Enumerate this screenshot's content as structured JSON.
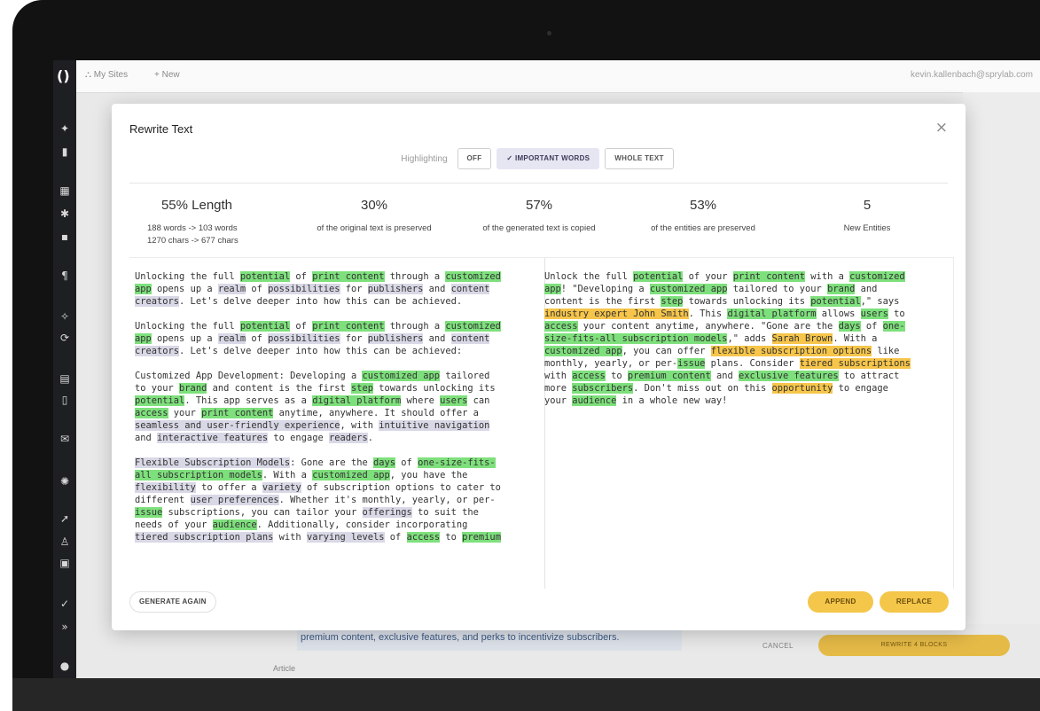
{
  "app": {
    "topbar": {
      "my_sites": "My Sites",
      "new": "+ New",
      "user_email": "kevin.kallenbach@sprylab.com"
    },
    "background": {
      "article_strip": "premium content, exclusive features, and perks to incentivize subscribers.",
      "article_label": "Article",
      "cancel_label": "CANCEL",
      "rewrite_label": "REWRITE 4 BLOCKS"
    }
  },
  "modal": {
    "title": "Rewrite Text",
    "close_icon": "×",
    "highlighting": {
      "label": "Highlighting",
      "options": [
        "OFF",
        "✓ IMPORTANT WORDS",
        "WHOLE TEXT"
      ],
      "selected": "IMPORTANT WORDS"
    },
    "stats": [
      {
        "value": "55% Length",
        "desc": "188 words -> 103 words\n1270 chars -> 677 chars"
      },
      {
        "value": "30%",
        "desc": "of the original text is preserved"
      },
      {
        "value": "57%",
        "desc": "of the generated text is copied"
      },
      {
        "value": "53%",
        "desc": "of the entities are preserved"
      },
      {
        "value": "5",
        "desc": "New Entities"
      }
    ],
    "buttons": {
      "generate_again": "GENERATE AGAIN",
      "append": "APPEND",
      "replace": "REPLACE"
    }
  },
  "colors": {
    "highlight_green": "#7ee07c",
    "highlight_yellow": "#f6c54a",
    "highlight_gray": "#d8d8e6",
    "button_yellow": "#f4c64a"
  },
  "original_text": [
    [
      [
        "Unlocking the full ",
        ""
      ],
      [
        "potential",
        "g"
      ],
      [
        " of ",
        ""
      ],
      [
        "print content",
        "g"
      ],
      [
        " through a ",
        ""
      ],
      [
        "customized\napp",
        "g"
      ],
      [
        " opens up a ",
        ""
      ],
      [
        "realm",
        "p"
      ],
      [
        " of ",
        ""
      ],
      [
        "possibilities",
        "p"
      ],
      [
        " for ",
        ""
      ],
      [
        "publishers",
        "p"
      ],
      [
        " and ",
        ""
      ],
      [
        "content\ncreators",
        "p"
      ],
      [
        ". Let's delve deeper into how this can be achieved.",
        ""
      ]
    ],
    [
      [
        "Unlocking the full ",
        ""
      ],
      [
        "potential",
        "g"
      ],
      [
        " of ",
        ""
      ],
      [
        "print content",
        "g"
      ],
      [
        " through a ",
        ""
      ],
      [
        "customized\napp",
        "g"
      ],
      [
        " opens up a ",
        ""
      ],
      [
        "realm",
        "p"
      ],
      [
        " of ",
        ""
      ],
      [
        "possibilities",
        "p"
      ],
      [
        " for ",
        ""
      ],
      [
        "publishers",
        "p"
      ],
      [
        " and ",
        ""
      ],
      [
        "content\ncreators",
        "p"
      ],
      [
        ". Let's delve deeper into how this can be achieved:",
        ""
      ]
    ],
    [
      [
        "Customized App Development: Developing a ",
        ""
      ],
      [
        "customized app",
        "g"
      ],
      [
        " tailored\nto your ",
        ""
      ],
      [
        "brand",
        "g"
      ],
      [
        " and content is the first ",
        ""
      ],
      [
        "step",
        "g"
      ],
      [
        " towards unlocking its\n",
        ""
      ],
      [
        "potential",
        "g"
      ],
      [
        ". This app serves as a ",
        ""
      ],
      [
        "digital platform",
        "g"
      ],
      [
        " where ",
        ""
      ],
      [
        "users",
        "g"
      ],
      [
        " can\n",
        ""
      ],
      [
        "access",
        "g"
      ],
      [
        " your ",
        ""
      ],
      [
        "print content",
        "g"
      ],
      [
        " anytime, anywhere. It should offer a\n",
        ""
      ],
      [
        "seamless and user-friendly experience",
        "p"
      ],
      [
        ", with ",
        ""
      ],
      [
        "intuitive navigation",
        "p"
      ],
      [
        "\nand ",
        ""
      ],
      [
        "interactive features",
        "p"
      ],
      [
        " to engage ",
        ""
      ],
      [
        "readers",
        "p"
      ],
      [
        ".",
        ""
      ]
    ],
    [
      [
        "Flexible Subscription Models",
        "p"
      ],
      [
        ": Gone are the ",
        ""
      ],
      [
        "days",
        "g"
      ],
      [
        " of ",
        ""
      ],
      [
        "one-size-fits-\nall subscription models",
        "g"
      ],
      [
        ". With a ",
        ""
      ],
      [
        "customized app",
        "g"
      ],
      [
        ", you have the\n",
        ""
      ],
      [
        "flexibility",
        "p"
      ],
      [
        " to offer a ",
        ""
      ],
      [
        "variety",
        "p"
      ],
      [
        " of subscription options to cater to\ndifferent ",
        ""
      ],
      [
        "user preferences",
        "p"
      ],
      [
        ". Whether it's monthly, yearly, or per-\n",
        ""
      ],
      [
        "issue",
        "g"
      ],
      [
        " subscriptions, you can tailor your ",
        ""
      ],
      [
        "offerings",
        "p"
      ],
      [
        " to suit the\nneeds of your ",
        ""
      ],
      [
        "audience",
        "g"
      ],
      [
        ". Additionally, consider incorporating\n",
        ""
      ],
      [
        "tiered subscription plans",
        "p"
      ],
      [
        " with ",
        ""
      ],
      [
        "varying levels",
        "p"
      ],
      [
        " of ",
        ""
      ],
      [
        "access",
        "g"
      ],
      [
        " to ",
        ""
      ],
      [
        "premium",
        "g"
      ]
    ]
  ],
  "generated_text": [
    [
      [
        "Unlock the full ",
        ""
      ],
      [
        "potential",
        "g"
      ],
      [
        " of your ",
        ""
      ],
      [
        "print content",
        "g"
      ],
      [
        " with a ",
        ""
      ],
      [
        "customized\napp",
        "g"
      ],
      [
        "! \"Developing a ",
        ""
      ],
      [
        "customized app",
        "g"
      ],
      [
        " tailored to your ",
        ""
      ],
      [
        "brand",
        "g"
      ],
      [
        " and\ncontent is the first ",
        ""
      ],
      [
        "step",
        "g"
      ],
      [
        " towards unlocking its ",
        ""
      ],
      [
        "potential",
        "g"
      ],
      [
        ",\" says\n",
        ""
      ],
      [
        "industry expert John Smith",
        "y"
      ],
      [
        ". This ",
        ""
      ],
      [
        "digital platform",
        "g"
      ],
      [
        " allows ",
        ""
      ],
      [
        "users",
        "g"
      ],
      [
        " to\n",
        ""
      ],
      [
        "access",
        "g"
      ],
      [
        " your content anytime, anywhere. \"Gone are the ",
        ""
      ],
      [
        "days",
        "g"
      ],
      [
        " of ",
        ""
      ],
      [
        "one-\nsize-fits-all subscription models",
        "g"
      ],
      [
        ",\" adds ",
        ""
      ],
      [
        "Sarah Brown",
        "y"
      ],
      [
        ". With a\n",
        ""
      ],
      [
        "customized app",
        "g"
      ],
      [
        ", you can offer ",
        ""
      ],
      [
        "flexible subscription options",
        "y"
      ],
      [
        " like\nmonthly, yearly, or per-",
        ""
      ],
      [
        "issue",
        "g"
      ],
      [
        " plans. Consider ",
        ""
      ],
      [
        "tiered subscriptions",
        "y"
      ],
      [
        "\nwith ",
        ""
      ],
      [
        "access",
        "g"
      ],
      [
        " to ",
        ""
      ],
      [
        "premium content",
        "g"
      ],
      [
        " and ",
        ""
      ],
      [
        "exclusive features",
        "g"
      ],
      [
        " to attract\nmore ",
        ""
      ],
      [
        "subscribers",
        "g"
      ],
      [
        ". Don't miss out on this ",
        ""
      ],
      [
        "opportunity",
        "y"
      ],
      [
        " to engage\nyour ",
        ""
      ],
      [
        "audience",
        "g"
      ],
      [
        " in a whole new way!",
        ""
      ]
    ]
  ]
}
